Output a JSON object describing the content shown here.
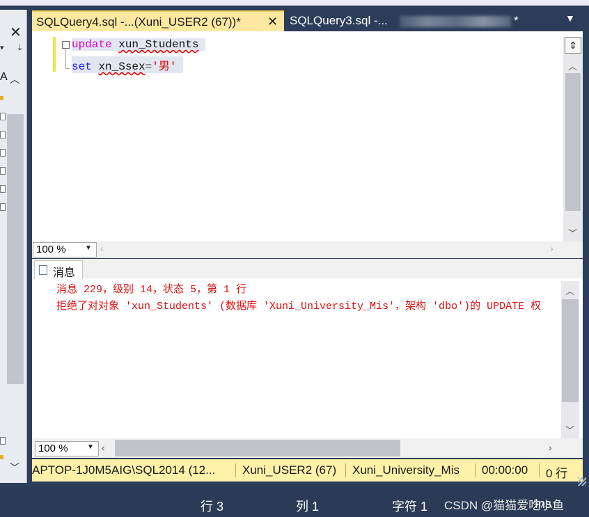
{
  "tabs": [
    {
      "label": "SQLQuery4.sql -...(Xuni_USER2 (67))*",
      "active": true
    },
    {
      "label": "SQLQuery3.sql -...",
      "suffix": "*",
      "active": false
    }
  ],
  "left_panel": {
    "letter": "A"
  },
  "editor": {
    "line1": {
      "keyword": "update",
      "identifier": "xun_Students"
    },
    "line2": {
      "keyword": "set",
      "identifier": "xn_Ssex",
      "operator": "=",
      "value": "'男'"
    },
    "zoom": "100 %"
  },
  "results": {
    "tab_label": "消息",
    "messages": [
      "消息 229，级别 14，状态 5，第 1 行",
      "拒绝了对对象 'xun_Students' (数据库 'Xuni_University_Mis'，架构 'dbo')的 UPDATE 权"
    ],
    "zoom": "100 %"
  },
  "connection": {
    "server": "APTOP-1J0M5AIG\\SQL2014 (12...",
    "user": "Xuni_USER2 (67)",
    "database": "Xuni_University_Mis",
    "elapsed": "00:00:00",
    "rows": "0 行"
  },
  "status_bar": {
    "row": "行 3",
    "column": "列 1",
    "char": "字符 1",
    "mode": "Ins"
  },
  "watermark": "CSDN @猫猫爱吃小鱼",
  "colors": {
    "active_tab": "#fce8a0",
    "connection_bar": "#fff1a8",
    "error_text": "#e01010",
    "chrome": "#2b3a55"
  }
}
